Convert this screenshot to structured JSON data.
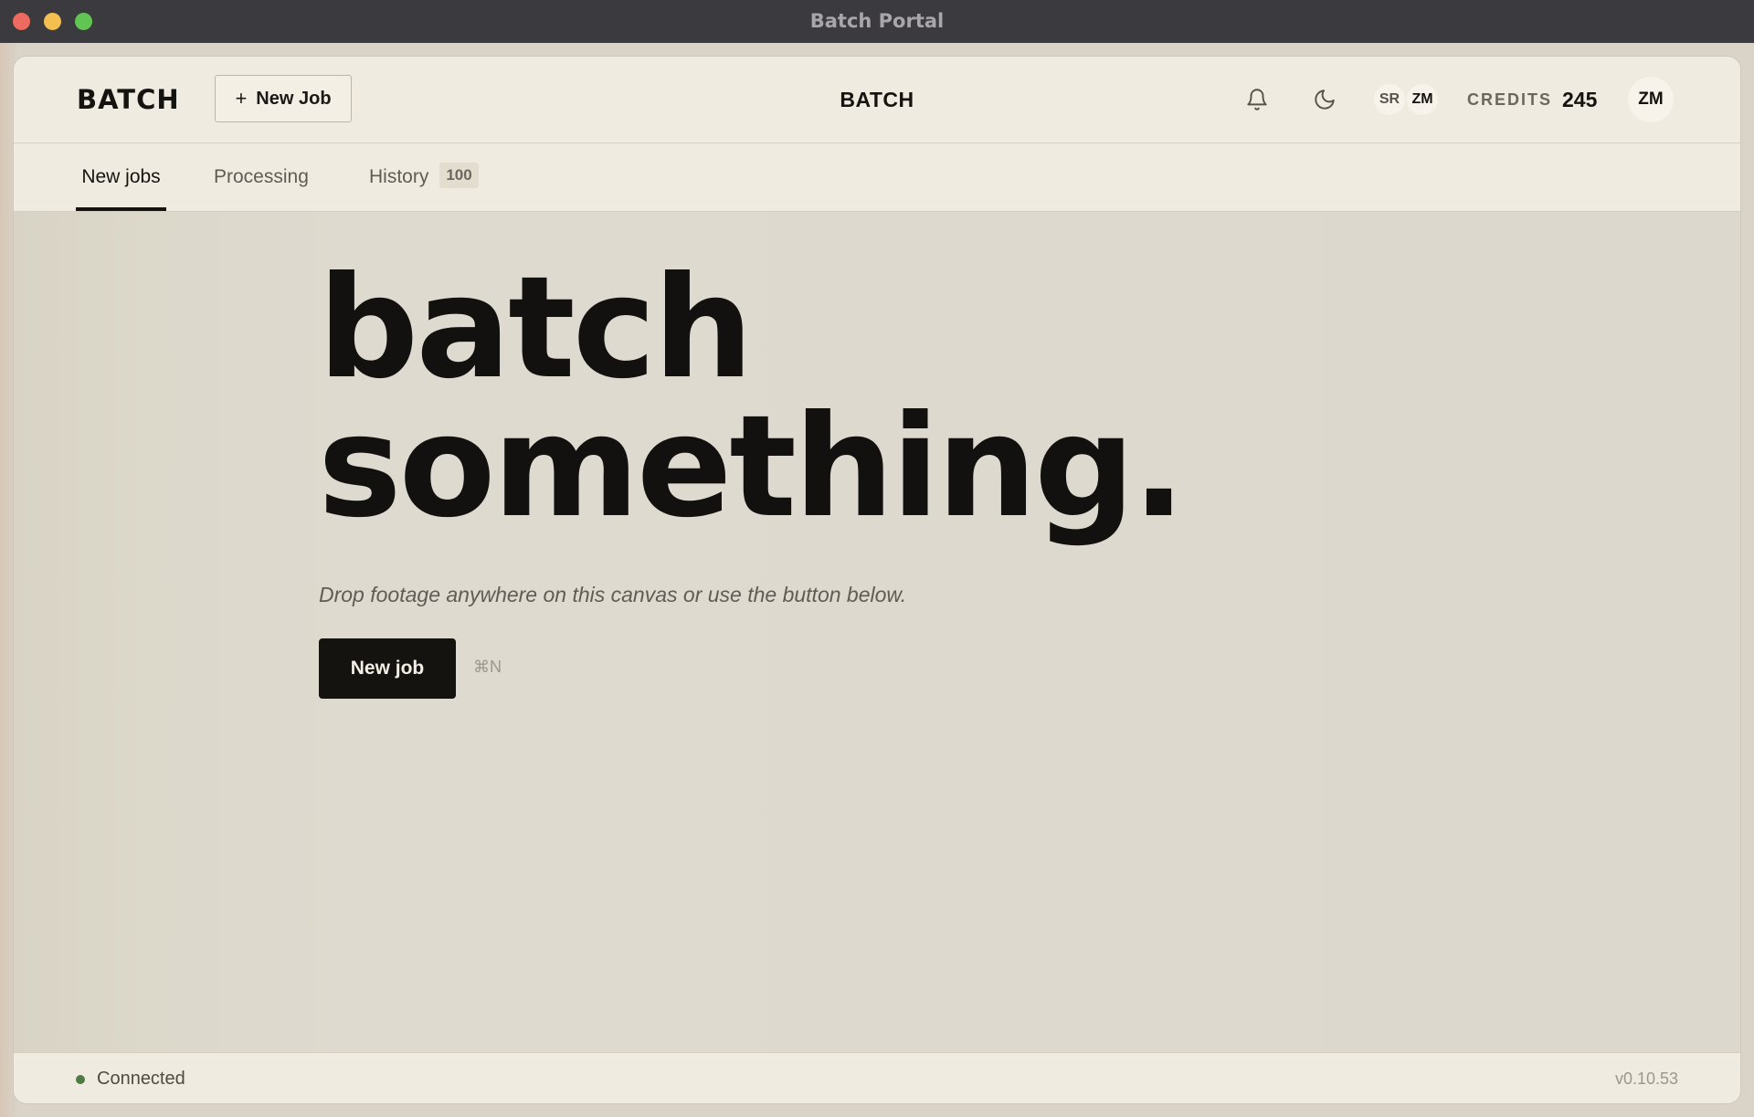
{
  "window": {
    "title": "Batch Portal"
  },
  "header": {
    "logo": "BATCH",
    "new_job_label": "New Job",
    "new_job_icon": "plus-icon",
    "center_title": "BATCH",
    "avatars": [
      "SR",
      "ZM"
    ],
    "credits_label": "CREDITS",
    "credits_value": "245",
    "user_initials": "ZM"
  },
  "tabs": [
    {
      "label": "New jobs",
      "active": true
    },
    {
      "label": "Processing",
      "active": false
    },
    {
      "label": "History",
      "active": false,
      "badge": "100"
    }
  ],
  "hero": {
    "title_line1": "batch",
    "title_line2": "something.",
    "subtitle": "Drop footage anywhere on this canvas or use the button below.",
    "button_label": "New job",
    "shortcut": "⌘N"
  },
  "status": {
    "text": "Connected",
    "version": "v0.10.53",
    "color": "#4f7a45"
  },
  "colors": {
    "accent": "#141310",
    "background": "#dedad0",
    "header_bg": "#f0ebe0"
  }
}
